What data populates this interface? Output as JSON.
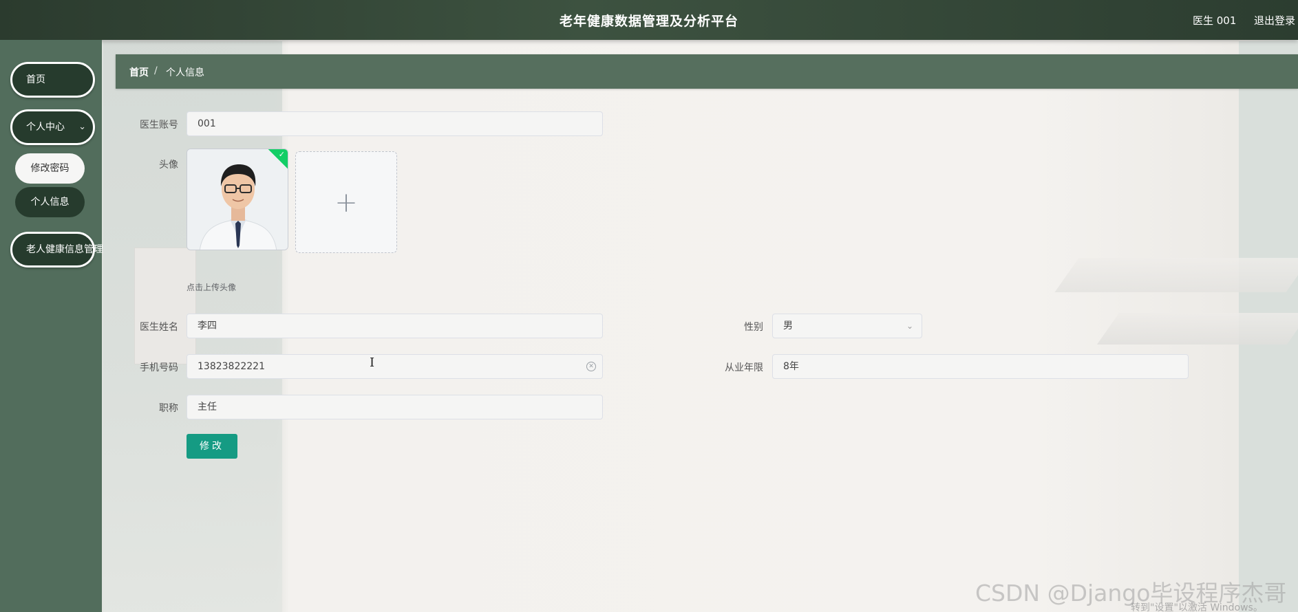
{
  "header": {
    "title": "老年健康数据管理及分析平台",
    "user": "医生 001",
    "logout": "退出登录"
  },
  "sidebar": {
    "items": [
      {
        "label": "首页"
      },
      {
        "label": "个人中心",
        "expanded": true,
        "children": [
          {
            "label": "修改密码"
          },
          {
            "label": "个人信息"
          }
        ]
      },
      {
        "label": "老人健康信息管理"
      }
    ]
  },
  "breadcrumb": {
    "home": "首页",
    "separator": "/",
    "current": "个人信息"
  },
  "form": {
    "account_label": "医生账号",
    "account_value": "001",
    "avatar_label": "头像",
    "avatar_hint": "点击上传头像",
    "name_label": "医生姓名",
    "name_value": "李四",
    "gender_label": "性别",
    "gender_value": "男",
    "phone_label": "手机号码",
    "phone_value": "13823822221",
    "years_label": "从业年限",
    "years_value": "8年",
    "title_label": "职称",
    "title_value": "主任",
    "submit_label": "修改"
  },
  "overlay": {
    "watermark": "CSDN @Django毕设程序杰哥",
    "windows_note": "转到\"设置\"以激活 Windows。"
  },
  "colors": {
    "header": "#2f4233",
    "sidebar": "#526d5c",
    "pill": "#263b2d",
    "accent_button": "#159b83",
    "success": "#13ce66"
  }
}
